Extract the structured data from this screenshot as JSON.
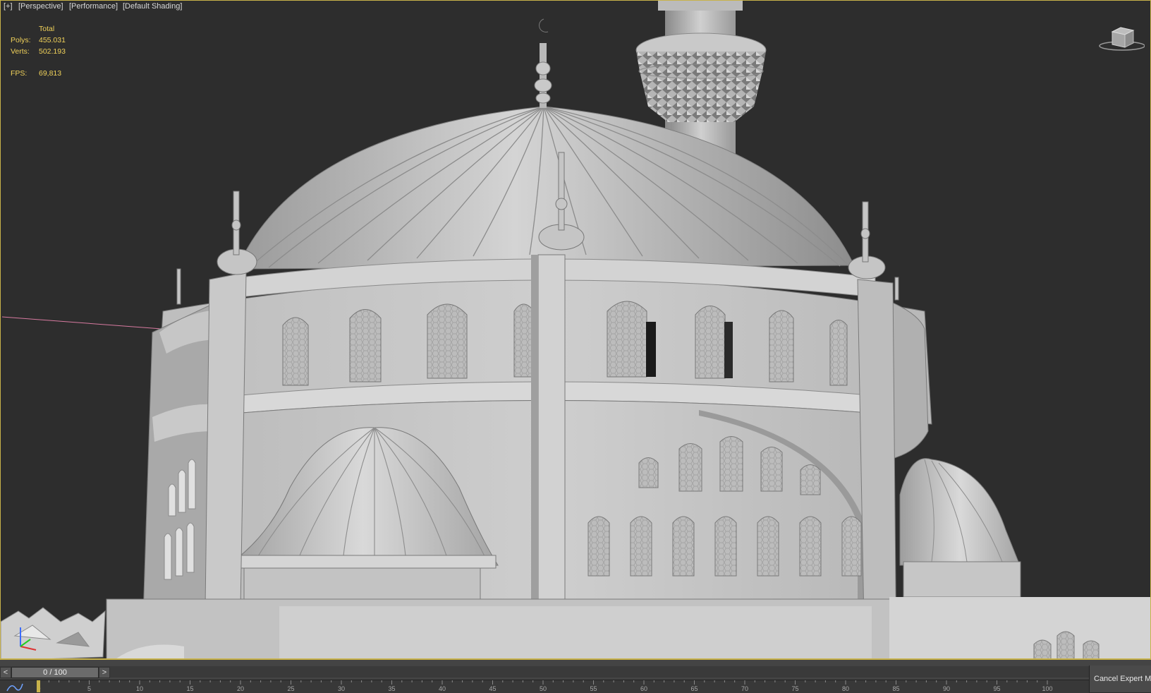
{
  "viewport": {
    "labels": [
      "[+]",
      "[Perspective]",
      "[Performance]",
      "[Default Shading]"
    ],
    "stats": {
      "header": "Total",
      "polys_label": "Polys:",
      "polys_value": "455.031",
      "verts_label": "Verts:",
      "verts_value": "502.193",
      "fps_label": "FPS:",
      "fps_value": "69,813"
    },
    "viewcube_icon": "viewcube-icon"
  },
  "timeline": {
    "prev_label": "<",
    "next_label": ">",
    "frame_display": "0 / 100",
    "ruler_ticks": [
      "0",
      "5",
      "10",
      "15",
      "20",
      "25",
      "30",
      "35",
      "40",
      "45",
      "50",
      "55",
      "60",
      "65",
      "70",
      "75",
      "80",
      "85",
      "90",
      "95",
      "100"
    ],
    "cancel_label": "Cancel Expert M"
  },
  "colors": {
    "viewport_bg": "#2d2d2d",
    "active_border": "#c8b24a",
    "stats_text": "#f1d25a",
    "model": "#c8c8c8"
  }
}
